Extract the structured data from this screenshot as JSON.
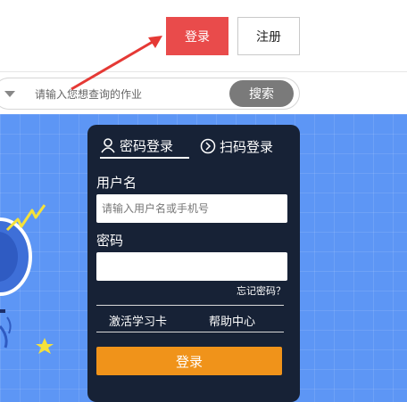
{
  "header": {
    "login_label": "登录",
    "register_label": "注册"
  },
  "search": {
    "placeholder": "请输入您想查询的作业",
    "button_label": "搜索"
  },
  "login_panel": {
    "tabs": [
      {
        "label": "密码登录",
        "icon": "user-icon",
        "active": true
      },
      {
        "label": "扫码登录",
        "icon": "chevron-right-circle-icon",
        "active": false
      }
    ],
    "username_label": "用户名",
    "username_placeholder": "请输入用户名或手机号",
    "password_label": "密码",
    "password_value": "",
    "forgot_password": "忘记密码？",
    "activate_card": "激活学习卡",
    "help_center": "帮助中心",
    "submit_label": "登录"
  },
  "colors": {
    "login_red": "#e94b4b",
    "search_button": "#7a7a7a",
    "hero_blue": "#5d96f5",
    "panel_dark": "#172236",
    "submit_orange": "#f0931a"
  }
}
